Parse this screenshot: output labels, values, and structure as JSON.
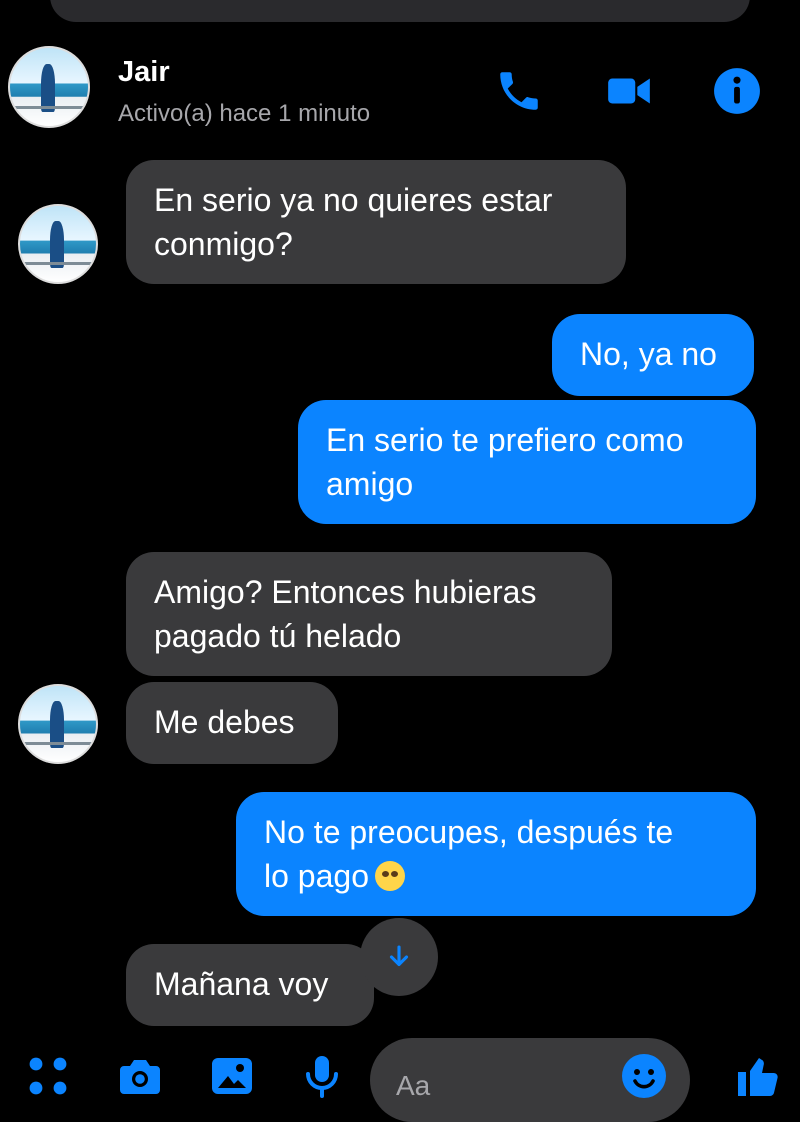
{
  "header": {
    "contact_name": "Jair",
    "status": "Activo(a) hace 1 minuto",
    "icons": [
      "phone-icon",
      "video-icon",
      "info-icon"
    ]
  },
  "messages": [
    {
      "side": "in",
      "text": "En serio ya no quieres estar\nconmigo?"
    },
    {
      "side": "out",
      "text": "No, ya no"
    },
    {
      "side": "out",
      "text": "En serio te prefiero como\namigo"
    },
    {
      "side": "in",
      "text": "Amigo? Entonces hubieras\npagado tú helado"
    },
    {
      "side": "in",
      "text": "Me debes"
    },
    {
      "side": "out",
      "text": "No te preocupes, después te\nlo pago",
      "emoji": "face-with-rolling-eyes"
    },
    {
      "side": "in",
      "text": "Mañana voy"
    }
  ],
  "composer": {
    "placeholder": "Aa",
    "icons": [
      "apps-icon",
      "camera-icon",
      "gallery-icon",
      "mic-icon",
      "emoji-icon",
      "like-icon"
    ]
  },
  "colors": {
    "accent": "#0b84ff",
    "incoming_bubble": "#3a3a3c",
    "background": "#000000",
    "status_text": "#a7a7ab"
  }
}
